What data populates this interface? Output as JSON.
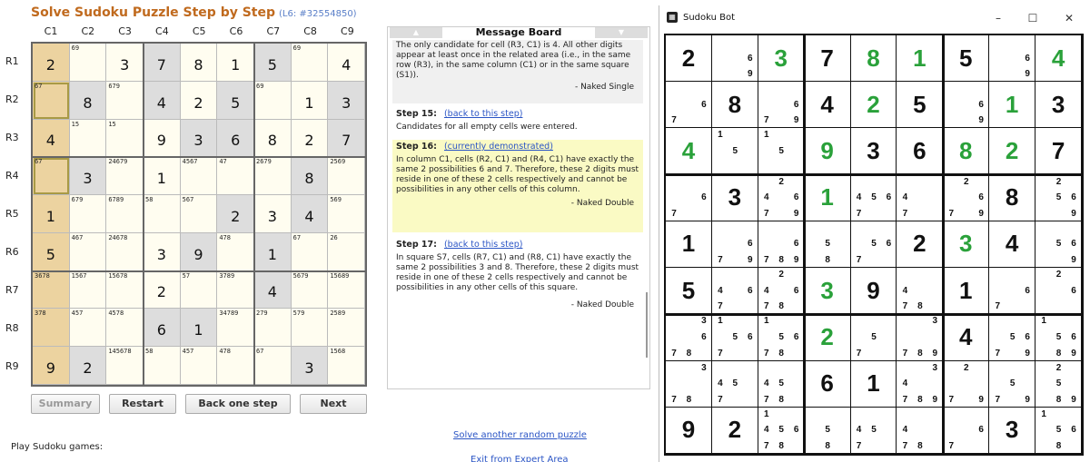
{
  "solver": {
    "title": "Solve Sudoku Puzzle Step by Step",
    "puzzle_id": "(L6: #32554850)",
    "col_labels": [
      "C1",
      "C2",
      "C3",
      "C4",
      "C5",
      "C6",
      "C7",
      "C8",
      "C9"
    ],
    "row_labels": [
      "R1",
      "R2",
      "R3",
      "R4",
      "R5",
      "R6",
      "R7",
      "R8",
      "R9"
    ],
    "grid": [
      [
        {
          "v": "2",
          "hl": true
        },
        {
          "c": "69"
        },
        {
          "v": "3"
        },
        {
          "v": "7",
          "g": true
        },
        {
          "v": "8"
        },
        {
          "v": "1"
        },
        {
          "v": "5",
          "g": true
        },
        {
          "c": "69"
        },
        {
          "v": "4"
        }
      ],
      [
        {
          "c": "67",
          "hl": true,
          "sel": true
        },
        {
          "v": "8",
          "g": true
        },
        {
          "c": "679"
        },
        {
          "v": "4",
          "g": true
        },
        {
          "v": "2"
        },
        {
          "v": "5",
          "g": true
        },
        {
          "c": "69"
        },
        {
          "v": "1"
        },
        {
          "v": "3",
          "g": true
        }
      ],
      [
        {
          "v": "4",
          "hl": true
        },
        {
          "c": "15"
        },
        {
          "c": "15"
        },
        {
          "v": "9"
        },
        {
          "v": "3",
          "g": true
        },
        {
          "v": "6",
          "g": true
        },
        {
          "v": "8"
        },
        {
          "v": "2"
        },
        {
          "v": "7",
          "g": true
        }
      ],
      [
        {
          "c": "67",
          "hl": true,
          "sel": true
        },
        {
          "v": "3",
          "g": true
        },
        {
          "c": "24679"
        },
        {
          "v": "1"
        },
        {
          "c": "4567"
        },
        {
          "c": "47"
        },
        {
          "c": "2679"
        },
        {
          "v": "8",
          "g": true
        },
        {
          "c": "2569"
        }
      ],
      [
        {
          "v": "1",
          "hl": true
        },
        {
          "c": "679"
        },
        {
          "c": "6789"
        },
        {
          "c": "58"
        },
        {
          "c": "567"
        },
        {
          "v": "2",
          "g": true
        },
        {
          "v": "3"
        },
        {
          "v": "4",
          "g": true
        },
        {
          "c": "569"
        }
      ],
      [
        {
          "v": "5",
          "hl": true
        },
        {
          "c": "467"
        },
        {
          "c": "24678"
        },
        {
          "v": "3"
        },
        {
          "v": "9",
          "g": true
        },
        {
          "c": "478"
        },
        {
          "v": "1",
          "g": true
        },
        {
          "c": "67"
        },
        {
          "c": "26"
        }
      ],
      [
        {
          "c": "3678",
          "hl": true
        },
        {
          "c": "1567"
        },
        {
          "c": "15678"
        },
        {
          "v": "2"
        },
        {
          "c": "57"
        },
        {
          "c": "3789"
        },
        {
          "v": "4",
          "g": true
        },
        {
          "c": "5679"
        },
        {
          "c": "15689"
        }
      ],
      [
        {
          "c": "378",
          "hl": true
        },
        {
          "c": "457"
        },
        {
          "c": "4578"
        },
        {
          "v": "6",
          "g": true
        },
        {
          "v": "1",
          "g": true
        },
        {
          "c": "34789"
        },
        {
          "c": "279"
        },
        {
          "c": "579"
        },
        {
          "c": "2589"
        }
      ],
      [
        {
          "v": "9",
          "hl": true
        },
        {
          "v": "2",
          "g": true
        },
        {
          "c": "145678"
        },
        {
          "c": "58"
        },
        {
          "c": "457"
        },
        {
          "c": "478"
        },
        {
          "c": "67"
        },
        {
          "v": "3",
          "g": true
        },
        {
          "c": "1568"
        }
      ]
    ],
    "buttons": {
      "summary": "Summary",
      "restart": "Restart",
      "back": "Back one step",
      "next": "Next"
    },
    "play_text": "Play Sudoku games:",
    "random_link": "Solve another random puzzle",
    "exit_link": "Exit from Expert Area"
  },
  "message_board": {
    "title": "Message Board",
    "prev_text": "The only candidate for cell (R3, C1) is 4. All other digits appear at least once in the related area (i.e., in the same row (R3), in the same column (C1) or in the same square (S1)).",
    "prev_tag": "- Naked Single",
    "step15_label": "Step 15:",
    "step15_link": "(back to this step)",
    "step15_text": "Candidates for all empty cells were entered.",
    "step16_label": "Step 16:",
    "step16_link": "(currently demonstrated)",
    "step16_text": "In column C1, cells (R2, C1) and (R4, C1) have exactly the same 2 possibilities 6 and 7. Therefore, these 2 digits must reside in one of these 2 cells respectively and cannot be possibilities in any other cells of this column.",
    "step16_tag": "- Naked Double",
    "step17_label": "Step 17:",
    "step17_link": "(back to this step)",
    "step17_text": "In square S7, cells (R7, C1) and (R8, C1) have exactly the same 2 possibilities 3 and 8. Therefore, these 2 digits must reside in one of these 2 cells respectively and cannot be possibilities in any other cells of this square.",
    "step17_tag": "- Naked Double"
  },
  "bot_window": {
    "title": "Sudoku Bot",
    "minimize": "–",
    "maximize": "☐",
    "close": "✕",
    "grid": [
      [
        {
          "v": "2"
        },
        {
          "p": [
            "6",
            "9"
          ]
        },
        {
          "v": "3",
          "g": true
        },
        {
          "v": "7"
        },
        {
          "v": "8",
          "g": true
        },
        {
          "v": "1",
          "g": true
        },
        {
          "v": "5"
        },
        {
          "p": [
            "6",
            "9"
          ]
        },
        {
          "v": "4",
          "g": true
        }
      ],
      [
        {
          "p": [
            "6",
            "7"
          ]
        },
        {
          "v": "8"
        },
        {
          "p": [
            "6",
            "7",
            "9"
          ]
        },
        {
          "v": "4"
        },
        {
          "v": "2",
          "g": true
        },
        {
          "v": "5"
        },
        {
          "p": [
            "6",
            "9"
          ]
        },
        {
          "v": "1",
          "g": true
        },
        {
          "v": "3"
        }
      ],
      [
        {
          "v": "4",
          "g": true
        },
        {
          "p": [
            "1",
            "5"
          ]
        },
        {
          "p": [
            "1",
            "5"
          ]
        },
        {
          "v": "9",
          "g": true
        },
        {
          "v": "3"
        },
        {
          "v": "6"
        },
        {
          "v": "8",
          "g": true
        },
        {
          "v": "2",
          "g": true
        },
        {
          "v": "7"
        }
      ],
      [
        {
          "p": [
            "6",
            "7"
          ]
        },
        {
          "v": "3"
        },
        {
          "p": [
            "2",
            "4",
            "6",
            "7",
            "9"
          ]
        },
        {
          "v": "1",
          "g": true
        },
        {
          "p": [
            "4",
            "5",
            "6",
            "7"
          ]
        },
        {
          "p": [
            "4",
            "7"
          ]
        },
        {
          "p": [
            "2",
            "6",
            "7",
            "9"
          ]
        },
        {
          "v": "8"
        },
        {
          "p": [
            "2",
            "5",
            "6",
            "9"
          ]
        }
      ],
      [
        {
          "v": "1"
        },
        {
          "p": [
            "6",
            "7",
            "9"
          ]
        },
        {
          "p": [
            "6",
            "7",
            "8",
            "9"
          ]
        },
        {
          "p": [
            "5",
            "8"
          ]
        },
        {
          "p": [
            "5",
            "6",
            "7"
          ]
        },
        {
          "v": "2"
        },
        {
          "v": "3",
          "g": true
        },
        {
          "v": "4"
        },
        {
          "p": [
            "5",
            "6",
            "9"
          ]
        }
      ],
      [
        {
          "v": "5"
        },
        {
          "p": [
            "4",
            "6",
            "7"
          ]
        },
        {
          "p": [
            "2",
            "4",
            "6",
            "7",
            "8"
          ]
        },
        {
          "v": "3",
          "g": true
        },
        {
          "v": "9"
        },
        {
          "p": [
            "4",
            "7",
            "8"
          ]
        },
        {
          "v": "1"
        },
        {
          "p": [
            "6",
            "7"
          ]
        },
        {
          "p": [
            "2",
            "6"
          ]
        }
      ],
      [
        {
          "p": [
            "3",
            "6",
            "7",
            "8"
          ]
        },
        {
          "p": [
            "1",
            "5",
            "6",
            "7"
          ]
        },
        {
          "p": [
            "1",
            "5",
            "6",
            "7",
            "8"
          ]
        },
        {
          "v": "2",
          "g": true
        },
        {
          "p": [
            "5",
            "7"
          ]
        },
        {
          "p": [
            "3",
            "7",
            "8",
            "9"
          ]
        },
        {
          "v": "4"
        },
        {
          "p": [
            "5",
            "6",
            "7",
            "9"
          ]
        },
        {
          "p": [
            "1",
            "5",
            "6",
            "8",
            "9"
          ]
        }
      ],
      [
        {
          "p": [
            "3",
            "7",
            "8"
          ]
        },
        {
          "p": [
            "4",
            "5",
            "7"
          ]
        },
        {
          "p": [
            "4",
            "5",
            "7",
            "8"
          ]
        },
        {
          "v": "6"
        },
        {
          "v": "1"
        },
        {
          "p": [
            "3",
            "4",
            "7",
            "8",
            "9"
          ]
        },
        {
          "p": [
            "2",
            "7",
            "9"
          ]
        },
        {
          "p": [
            "5",
            "7",
            "9"
          ]
        },
        {
          "p": [
            "2",
            "5",
            "8",
            "9"
          ]
        }
      ],
      [
        {
          "v": "9"
        },
        {
          "v": "2"
        },
        {
          "p": [
            "1",
            "4",
            "5",
            "6",
            "7",
            "8"
          ]
        },
        {
          "p": [
            "5",
            "8"
          ]
        },
        {
          "p": [
            "4",
            "5",
            "7"
          ]
        },
        {
          "p": [
            "4",
            "7",
            "8"
          ]
        },
        {
          "p": [
            "6",
            "7"
          ]
        },
        {
          "v": "3"
        },
        {
          "p": [
            "1",
            "5",
            "6",
            "8"
          ]
        }
      ]
    ]
  }
}
